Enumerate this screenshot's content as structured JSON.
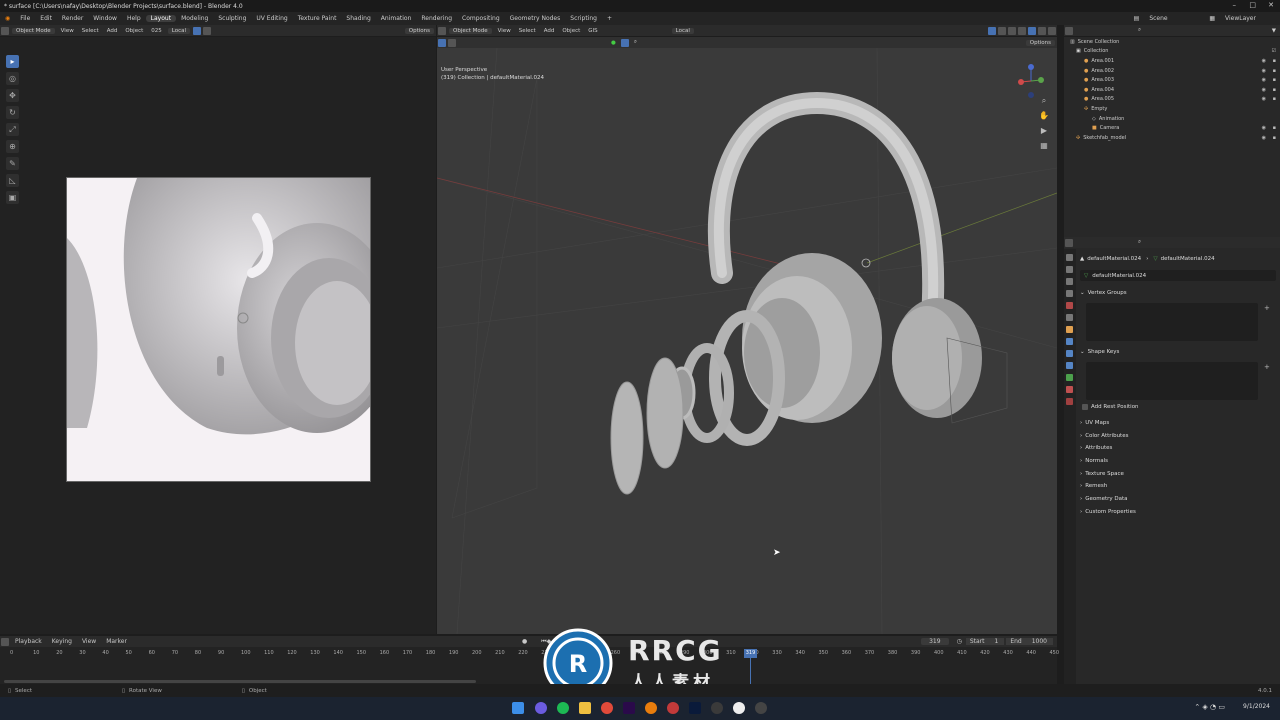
{
  "window": {
    "title": "* surface [C:\\Users\\nafay\\Desktop\\Blender Projects\\surface.blend] - Blender 4.0"
  },
  "menu": [
    "File",
    "Edit",
    "Render",
    "Window",
    "Help"
  ],
  "workspaces": [
    "Layout",
    "Modeling",
    "Sculpting",
    "UV Editing",
    "Texture Paint",
    "Shading",
    "Animation",
    "Rendering",
    "Compositing",
    "Geometry Nodes",
    "Scripting"
  ],
  "topbar": {
    "scene": "Scene",
    "view_layer": "ViewLayer"
  },
  "left_header": {
    "mode": "Object Mode",
    "items": [
      "View",
      "Select",
      "Add",
      "Object",
      "025"
    ],
    "orientation": "Local",
    "options": "Options"
  },
  "viewport_header": {
    "mode": "Object Mode",
    "items": [
      "View",
      "Select",
      "Add",
      "Object",
      "GIS"
    ],
    "orientation": "Local",
    "options": "Options"
  },
  "viewport": {
    "perspective": "User Perspective",
    "collection_info": "(319) Collection | defaultMaterial.024"
  },
  "outliner": {
    "root": "Scene Collection",
    "items": [
      {
        "label": "Collection",
        "indent": 1
      },
      {
        "label": "Area.001",
        "indent": 2
      },
      {
        "label": "Area.002",
        "indent": 2
      },
      {
        "label": "Area.003",
        "indent": 2
      },
      {
        "label": "Area.004",
        "indent": 2
      },
      {
        "label": "Area.005",
        "indent": 2
      },
      {
        "label": "Empty",
        "indent": 2
      },
      {
        "label": "Animation",
        "indent": 3
      },
      {
        "label": "Camera",
        "indent": 3
      },
      {
        "label": "Sketchfab_model",
        "indent": 1
      }
    ]
  },
  "properties": {
    "breadcrumb_object": "defaultMaterial.024",
    "breadcrumb_data": "defaultMaterial.024",
    "data_name": "defaultMaterial.024",
    "vertex_groups": "Vertex Groups",
    "shape_keys": "Shape Keys",
    "add_rest_position": "Add Rest Position",
    "panels": [
      "UV Maps",
      "Color Attributes",
      "Attributes",
      "Normals",
      "Texture Space",
      "Remesh",
      "Geometry Data",
      "Custom Properties"
    ]
  },
  "timeline": {
    "menu": [
      "Playback",
      "Keying",
      "View",
      "Marker"
    ],
    "current_frame": "319",
    "start_label": "Start",
    "start": "1",
    "end_label": "End",
    "end": "1000",
    "ticks": [
      "0",
      "10",
      "20",
      "30",
      "40",
      "50",
      "60",
      "70",
      "80",
      "90",
      "100",
      "110",
      "120",
      "130",
      "140",
      "150",
      "160",
      "170",
      "180",
      "190",
      "200",
      "210",
      "220",
      "230",
      "240",
      "250",
      "260",
      "270",
      "280",
      "290",
      "300",
      "310",
      "320",
      "330",
      "340",
      "350",
      "360",
      "370",
      "380",
      "390",
      "400",
      "410",
      "420",
      "430",
      "440",
      "450"
    ]
  },
  "statusbar": {
    "select": "Select",
    "rotate": "Rotate View",
    "object": "Object",
    "version": "4.0.1"
  },
  "watermark": {
    "main": "RRCG",
    "sub": "人人素材"
  },
  "taskbar": {
    "time": "",
    "date": "9/1/2024"
  }
}
